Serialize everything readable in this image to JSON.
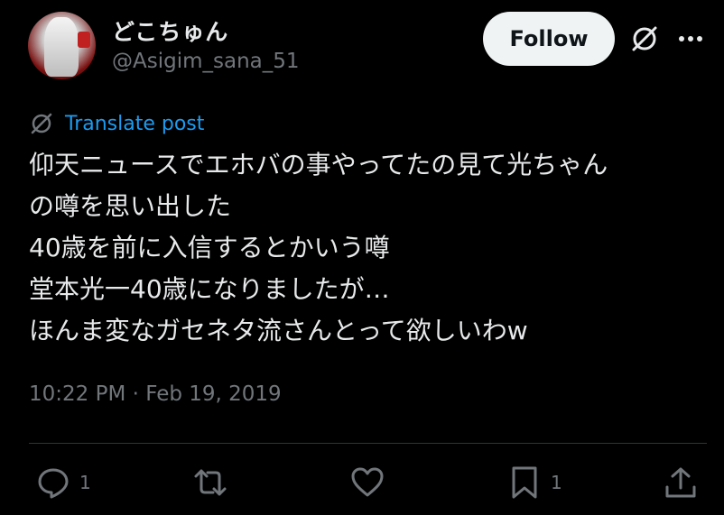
{
  "author": {
    "display_name": "どこちゅん",
    "handle": "@Asigim_sana_51"
  },
  "header": {
    "follow_label": "Follow",
    "grok_icon": "grok-icon",
    "more_icon": "more-icon"
  },
  "translate": {
    "label": "Translate post",
    "icon": "translate-icon"
  },
  "tweet": {
    "lines": [
      "仰天ニュースでエホバの事やってたの見て光ちゃん",
      "の噂を思い出した",
      "40歳を前に入信するとかいう噂",
      "堂本光一40歳になりましたが…",
      "ほんま変なガセネタ流さんとって欲しいわw"
    ],
    "timestamp": "10:22 PM · Feb 19, 2019"
  },
  "actions": {
    "reply_count": "1",
    "retweet_count": "",
    "like_count": "",
    "bookmark_count": "1"
  },
  "colors": {
    "background": "#000000",
    "text": "#e7e9ea",
    "secondary": "#71767b",
    "link": "#1d9bf0",
    "button_bg": "#eff3f4"
  }
}
